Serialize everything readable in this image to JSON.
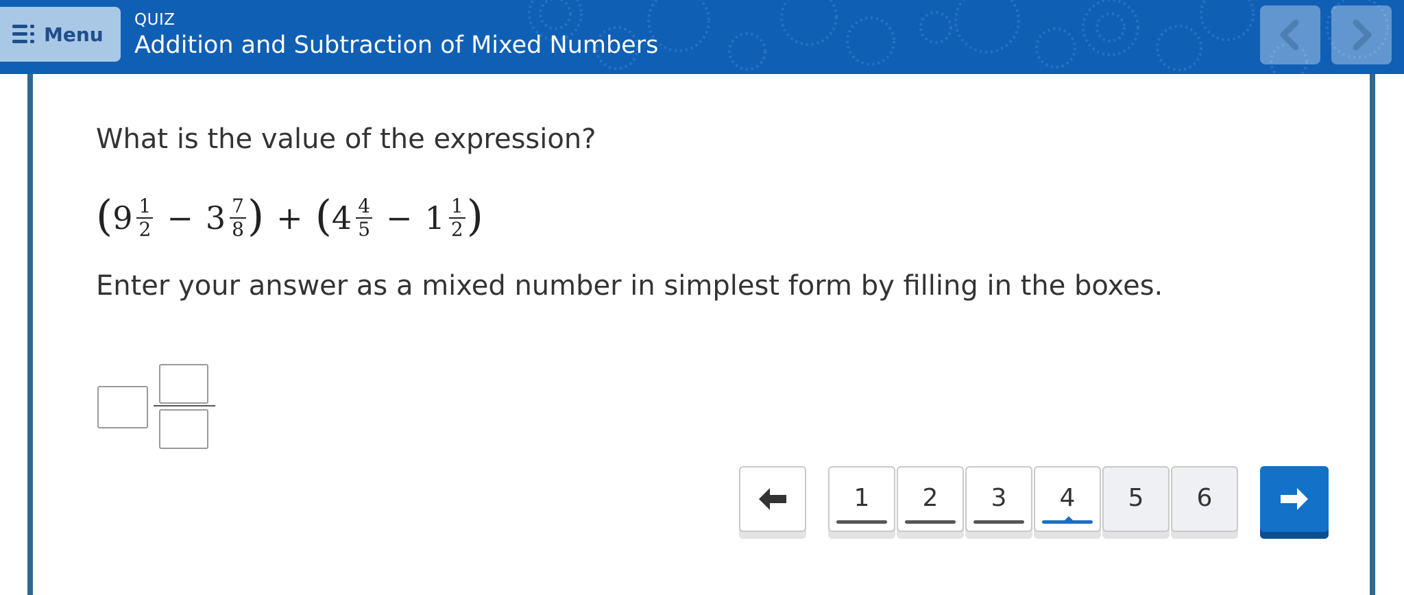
{
  "header": {
    "menu_label": "Menu",
    "section_label": "QUIZ",
    "title": "Addition and Subtraction of Mixed Numbers",
    "prev_icon": "chevron-left-icon",
    "next_icon": "chevron-right-icon",
    "background_color": "#0f5fb5"
  },
  "question": {
    "prompt": "What is the value of the expression?",
    "expression": {
      "open_paren_1": "(",
      "term1_whole": "9",
      "term1_num": "1",
      "term1_den": "2",
      "op1": "−",
      "term2_whole": "3",
      "term2_num": "7",
      "term2_den": "8",
      "close_paren_1": ")",
      "op_mid": "+",
      "open_paren_2": "(",
      "term3_whole": "4",
      "term3_num": "4",
      "term3_den": "5",
      "op2": "−",
      "term4_whole": "1",
      "term4_num": "1",
      "term4_den": "2",
      "close_paren_2": ")"
    },
    "instruction": "Enter your answer as a mixed number in simplest form by filling in the boxes.",
    "answer": {
      "whole": "",
      "numerator": "",
      "denominator": ""
    }
  },
  "pagination": {
    "back_icon": "arrow-left-icon",
    "forward_icon": "arrow-right-icon",
    "pages": [
      "1",
      "2",
      "3",
      "4",
      "5",
      "6"
    ],
    "current_page": "4",
    "accent_color": "#1371c8"
  }
}
